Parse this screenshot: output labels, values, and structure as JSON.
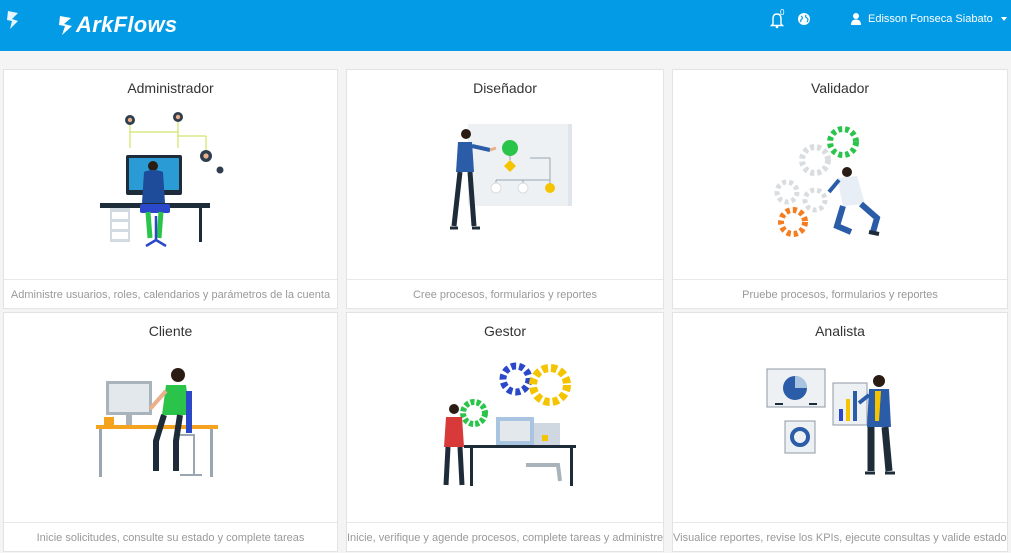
{
  "header": {
    "brand": "ArkFlows",
    "notification_count": "0",
    "user_name": "Edisson Fonseca Siabato",
    "bell_icon": "bell-icon",
    "globe_icon": "globe-icon",
    "user_icon": "user-icon",
    "caret_icon": "caret-down-icon",
    "background": "#039be5"
  },
  "cards": [
    {
      "title": "Administrador",
      "description": "Administre usuarios, roles, calendarios y parámetros de la cuenta"
    },
    {
      "title": "Diseñador",
      "description": "Cree procesos, formularios y reportes"
    },
    {
      "title": "Validador",
      "description": "Pruebe procesos, formularios y reportes"
    },
    {
      "title": "Cliente",
      "description": "Inicie solicitudes, consulte su estado y complete tareas"
    },
    {
      "title": "Gestor",
      "description": "Inicie, verifique y agende procesos, complete tareas y administre"
    },
    {
      "title": "Analista",
      "description": "Visualice reportes, revise los KPIs, ejecute consultas y valide estados"
    }
  ]
}
